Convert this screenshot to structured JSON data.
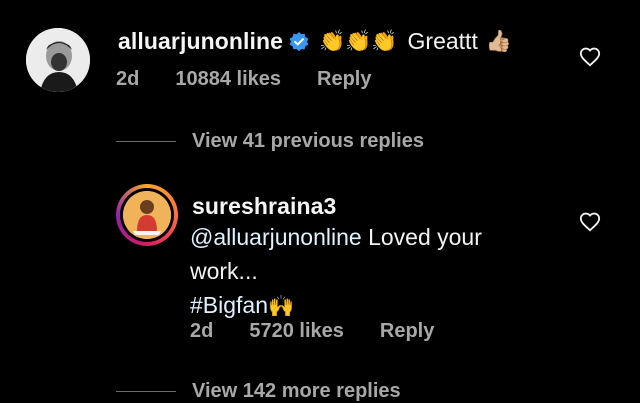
{
  "comment": {
    "username": "alluarjunonline",
    "verified_icon": "verified-badge-icon",
    "emojis": "👏👏👏",
    "text": "Greattt",
    "trailing_emoji": "👍🏼",
    "age": "2d",
    "likes": "10884 likes",
    "reply_label": "Reply"
  },
  "view_previous": "View 41 previous replies",
  "reply": {
    "username": "sureshraina3",
    "mention": "@alluarjunonline",
    "text_line1": " Loved your",
    "text_line2": "work...",
    "hashtag": "#Bigfan",
    "hashtag_emoji": "🙌",
    "age": "2d",
    "likes": "5720 likes",
    "reply_label": "Reply"
  },
  "view_more": "View 142 more replies",
  "colors": {
    "background": "#000000",
    "mention": "#e0f1ff",
    "verified": "#3897f0",
    "muted": "#a8a8a8"
  }
}
